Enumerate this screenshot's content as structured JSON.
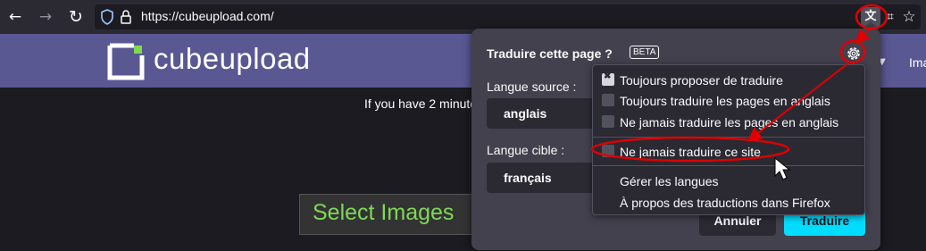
{
  "browser": {
    "url": "https://cubeupload.com/",
    "back_icon": "←",
    "forward_icon": "→",
    "reload_icon": "↻",
    "translate_icon": "文A",
    "extensions_icon": "⌗",
    "bookmark_icon": "☆"
  },
  "site": {
    "logo_text_a": "cube",
    "logo_text_b": "upload",
    "header_caret": "▼",
    "header_link": "Ima",
    "message": "If you have 2 minute",
    "select_button": "Select Images"
  },
  "translate_panel": {
    "title": "Traduire cette page ?",
    "beta": "BETA",
    "source_label": "Langue source :",
    "source_value": "anglais",
    "target_label": "Langue cible :",
    "target_value": "français",
    "cancel": "Annuler",
    "translate": "Traduire"
  },
  "settings_menu": {
    "items": [
      {
        "label": "Toujours proposer de traduire",
        "checked": true
      },
      {
        "label": "Toujours traduire les pages en anglais",
        "checked": false
      },
      {
        "label": "Ne jamais traduire les pages en anglais",
        "checked": false
      },
      {
        "label": "Ne jamais traduire ce site",
        "checked": false
      },
      {
        "label": "Gérer les langues"
      },
      {
        "label": "À propos des traductions dans Firefox"
      }
    ]
  },
  "colors": {
    "annotation": "#e00000",
    "accent": "#00ddff",
    "select_text": "#7ed957",
    "header": "#5a5893"
  }
}
